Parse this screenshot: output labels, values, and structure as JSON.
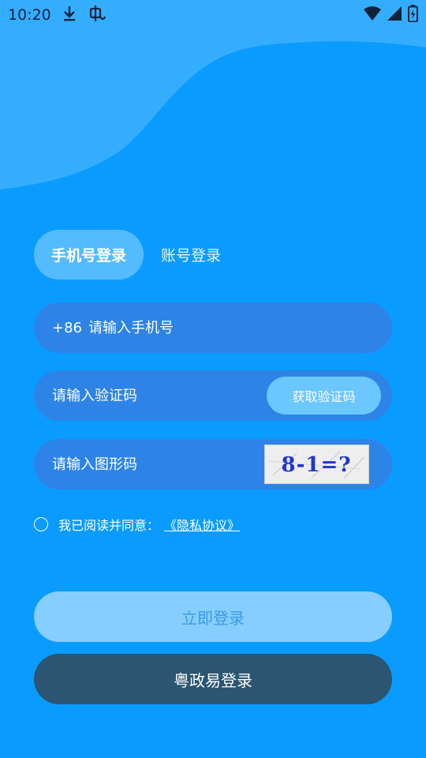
{
  "status_bar": {
    "time": "10:20",
    "icons": [
      "download-icon",
      "bug-icon",
      "wifi-icon",
      "signal-icon",
      "battery-charging-icon"
    ]
  },
  "tabs": {
    "phone_login": "手机号登录",
    "account_login": "账号登录"
  },
  "phone_field": {
    "prefix": "+86",
    "placeholder": "请输入手机号",
    "value": ""
  },
  "sms_field": {
    "placeholder": "请输入验证码",
    "value": "",
    "get_code_label": "获取验证码"
  },
  "captcha_field": {
    "placeholder": "请输入图形码",
    "value": "",
    "captcha_text": "8-1=?"
  },
  "agreement": {
    "checked": false,
    "text": "我已阅读并同意：",
    "link": "《隐私协议》"
  },
  "buttons": {
    "login": "立即登录",
    "yzy_login": "粤政易登录"
  },
  "colors": {
    "background": "#0a9bff",
    "wave": "#35adff",
    "field": "#2d84e6",
    "login_button": "#86ceff",
    "yzy_button": "#2b5571"
  }
}
